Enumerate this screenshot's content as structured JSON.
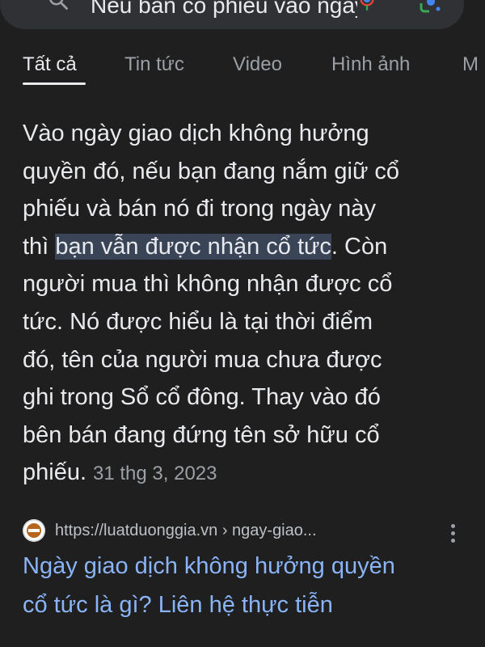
{
  "search": {
    "query": "Nếu bán cổ phiếu vào ngày giao dịch không hưởng quyền"
  },
  "tabs": [
    {
      "label": "Tất cả"
    },
    {
      "label": "Tin tức"
    },
    {
      "label": "Video"
    },
    {
      "label": "Hình ảnh"
    },
    {
      "label": "M"
    }
  ],
  "snippet": {
    "line1": "Vào ngày giao dịch không hưởng",
    "line2": "quyền đó, nếu bạn đang nắm giữ cổ",
    "line3": "phiếu và bán nó đi trong ngày này",
    "line4_pre": "thì ",
    "line4_highlight": "bạn vẫn được nhận cổ tức",
    "line4_post": ". Còn",
    "line5": "người mua thì không nhận được cổ",
    "line6": "tức. Nó được hiểu là tại thời điểm",
    "line7": "đó, tên của người mua chưa được",
    "line8": "ghi trong Sổ cổ đông. Thay vào đó",
    "line9": "bên bán đang đứng tên sở hữu cổ",
    "line10": "phiếu.",
    "date": "31 thg 3, 2023"
  },
  "source": {
    "url": "https://luatduonggia.vn › ngay-giao..."
  },
  "result": {
    "title_line1": "Ngày giao dịch không hưởng quyền",
    "title_line2": "cổ tức là gì? Liên hệ thực tiễn"
  }
}
